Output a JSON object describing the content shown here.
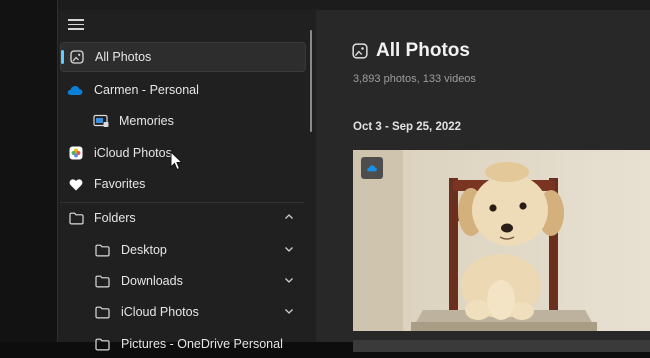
{
  "sidebar": {
    "items": [
      {
        "label": "All Photos",
        "icon": "photo-icon",
        "active": true
      },
      {
        "label": "Carmen - Personal",
        "icon": "onedrive-cloud-icon"
      },
      {
        "label": "Memories",
        "icon": "memories-icon"
      },
      {
        "label": "iCloud Photos",
        "icon": "icloud-photos-icon"
      },
      {
        "label": "Favorites",
        "icon": "heart-icon"
      }
    ],
    "folders": {
      "label": "Folders",
      "expanded": true,
      "children": [
        {
          "label": "Desktop"
        },
        {
          "label": "Downloads"
        },
        {
          "label": "iCloud Photos"
        },
        {
          "label": "Pictures - OneDrive Personal"
        }
      ]
    }
  },
  "main": {
    "title": "All Photos",
    "subtitle": "3,893 photos, 133 videos",
    "group_label": "Oct 3 - Sep 25, 2022"
  },
  "colors": {
    "accent": "#60cdff",
    "onedrive_blue": "#0a7fd8",
    "heart": "#ffffff"
  }
}
